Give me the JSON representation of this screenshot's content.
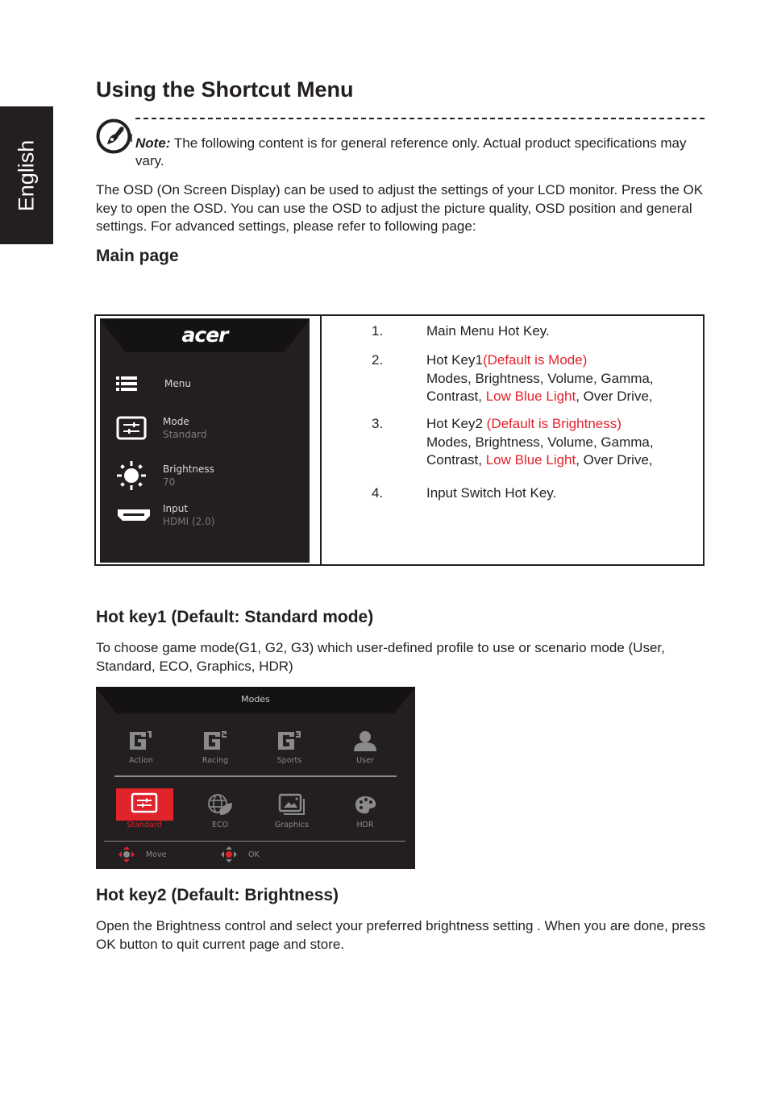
{
  "side_tab": {
    "label": "English"
  },
  "page": {
    "title": "Using the Shortcut Menu",
    "note": {
      "icon": "note-pen-icon",
      "prefix": "Note:",
      "text": " The following content is for general reference only. Actual product specifications may vary."
    },
    "intro": "The OSD (On Screen Display) can be used to adjust the settings of your LCD monitor. Press the OK key to open the OSD. You can use the OSD to adjust the picture quality, OSD position and general settings. For advanced settings, please refer to following page:",
    "main_page_heading": "Main page"
  },
  "osd_main": {
    "brand": "acer",
    "items": [
      {
        "icon": "menu-list-icon",
        "label": "Menu",
        "value": ""
      },
      {
        "icon": "mode-sliders-icon",
        "label": "Mode",
        "value": "Standard"
      },
      {
        "icon": "brightness-sun-icon",
        "label": "Brightness",
        "value": "70"
      },
      {
        "icon": "hdmi-port-icon",
        "label": "Input",
        "value": "HDMI (2.0)"
      }
    ]
  },
  "hotkey_list": [
    {
      "num": "1.",
      "title": "Main Menu Hot Key.",
      "title_red": "",
      "lines": []
    },
    {
      "num": "2.",
      "title": "Hot Key1",
      "title_red": "(Default is Mode)",
      "lines": [
        "Modes, Brightness, Volume, Gamma,"
      ],
      "line2_a": "Contrast, ",
      "line2_red": "Low Blue Light",
      "line2_b": ", Over Drive,"
    },
    {
      "num": "3.",
      "title": "Hot Key2 ",
      "title_red": "(Default is Brightness)",
      "lines": [
        "Modes, Brightness, Volume, Gamma,"
      ],
      "line2_a": "Contrast, ",
      "line2_red": "Low Blue Light",
      "line2_b": ", Over Drive,"
    },
    {
      "num": "4.",
      "title": "Input Switch Hot Key.",
      "title_red": "",
      "lines": []
    }
  ],
  "hotkey1": {
    "heading": "Hot key1 (Default: Standard mode)",
    "text": "To choose game mode(G1, G2, G3) which user-defined profile to use or scenario mode (User, Standard, ECO, Graphics, HDR)"
  },
  "modes_osd": {
    "title": "Modes",
    "row1": [
      {
        "icon": "g1-icon",
        "label": "Action"
      },
      {
        "icon": "g2-icon",
        "label": "Racing"
      },
      {
        "icon": "g3-icon",
        "label": "Sports"
      },
      {
        "icon": "user-icon",
        "label": "User"
      }
    ],
    "row2": [
      {
        "icon": "standard-sliders-icon",
        "label": "Standard",
        "selected": true
      },
      {
        "icon": "eco-globe-leaf-icon",
        "label": "ECO",
        "selected": false
      },
      {
        "icon": "graphics-images-icon",
        "label": "Graphics",
        "selected": false
      },
      {
        "icon": "hdr-palette-icon",
        "label": "HDR",
        "selected": false
      }
    ],
    "footer": [
      {
        "icon": "joystick-move-icon",
        "label": "Move"
      },
      {
        "icon": "joystick-ok-icon",
        "label": "OK"
      }
    ],
    "colors": {
      "accent": "#e1232c",
      "background": "#231f20",
      "muted": "#8a8a8a"
    }
  },
  "hotkey2": {
    "heading": "Hot key2 (Default: Brightness)",
    "text": "Open the Brightness control and select your preferred brightness setting . When you are done, press OK button to quit current page and store."
  }
}
